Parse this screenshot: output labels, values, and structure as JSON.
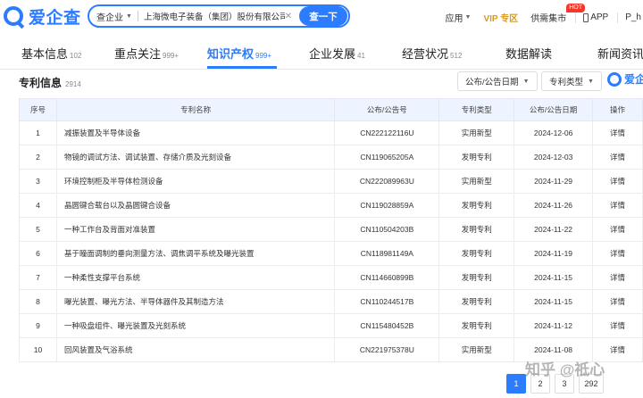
{
  "brand": {
    "name": "爱企查",
    "color": "#2b7cff"
  },
  "search": {
    "scope": "查企业",
    "query": "上海微电子装备（集团）股份有限公司",
    "button": "查一下"
  },
  "topnav": {
    "apply": "应用",
    "vip": "VIP 专区",
    "supply": "供需集市",
    "hot_badge": "HOT",
    "app": "APP",
    "user": "P_h"
  },
  "tabs": [
    {
      "label": "基本信息",
      "count": "102",
      "active": false
    },
    {
      "label": "重点关注",
      "count": "999+",
      "active": false
    },
    {
      "label": "知识产权",
      "count": "999+",
      "active": true
    },
    {
      "label": "企业发展",
      "count": "41",
      "active": false
    },
    {
      "label": "经营状况",
      "count": "512",
      "active": false
    },
    {
      "label": "数据解读",
      "count": "",
      "active": false
    },
    {
      "label": "新闻资讯",
      "count": "",
      "active": false
    }
  ],
  "section": {
    "title": "专利信息",
    "count": "2914",
    "filter_date": "公布/公告日期",
    "filter_type": "专利类型",
    "brand_mini": "爱企查"
  },
  "table": {
    "headers": [
      "序号",
      "专利名称",
      "公布/公告号",
      "专利类型",
      "公布/公告日期",
      "操作"
    ],
    "rows": [
      [
        "1",
        "减振装置及半导体设备",
        "CN222122116U",
        "实用新型",
        "2024-12-06",
        "详情"
      ],
      [
        "2",
        "物镜的调试方法、调试装置、存储介质及光刻设备",
        "CN119065205A",
        "发明专利",
        "2024-12-03",
        "详情"
      ],
      [
        "3",
        "环境控制柜及半导体检测设备",
        "CN222089963U",
        "实用新型",
        "2024-11-29",
        "详情"
      ],
      [
        "4",
        "晶圆键合载台以及晶圆键合设备",
        "CN119028859A",
        "发明专利",
        "2024-11-26",
        "详情"
      ],
      [
        "5",
        "一种工作台及背面对准装置",
        "CN110504203B",
        "发明专利",
        "2024-11-22",
        "详情"
      ],
      [
        "6",
        "基于瞳面调制的垂向测量方法、调焦调平系统及曝光装置",
        "CN118981149A",
        "发明专利",
        "2024-11-19",
        "详情"
      ],
      [
        "7",
        "一种柔性支撑平台系统",
        "CN114660899B",
        "发明专利",
        "2024-11-15",
        "详情"
      ],
      [
        "8",
        "曝光装置、曝光方法、半导体器件及其制造方法",
        "CN110244517B",
        "发明专利",
        "2024-11-15",
        "详情"
      ],
      [
        "9",
        "一种吸盘组件、曝光装置及光刻系统",
        "CN115480452B",
        "发明专利",
        "2024-11-12",
        "详情"
      ],
      [
        "10",
        "回风装置及气浴系统",
        "CN221975378U",
        "实用新型",
        "2024-11-08",
        "详情"
      ]
    ]
  },
  "pagination": {
    "pages": [
      "1",
      "2",
      "3",
      "292"
    ],
    "current": "1"
  },
  "watermark": "知乎 @祗心"
}
